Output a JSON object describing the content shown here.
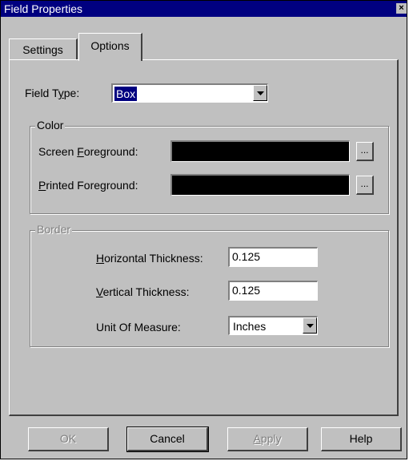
{
  "window": {
    "title": "Field Properties",
    "close_glyph": "×"
  },
  "tabs": [
    {
      "label": "Settings",
      "active": false
    },
    {
      "label": "Options",
      "active": true
    }
  ],
  "field_type": {
    "label": "Field Type:",
    "value": "Box"
  },
  "color_group": {
    "legend": "Color",
    "screen_foreground": {
      "label": "Screen Foreground:",
      "color": "#000000",
      "button": "..."
    },
    "printed_foreground": {
      "label": "Printed Foreground:",
      "color": "#000000",
      "button": "..."
    }
  },
  "border_group": {
    "legend": "Border",
    "horizontal_thickness": {
      "label": "Horizontal Thickness:",
      "value": "0.125"
    },
    "vertical_thickness": {
      "label": "Vertical Thickness:",
      "value": "0.125"
    },
    "unit_of_measure": {
      "label": "Unit Of Measure:",
      "value": "Inches"
    }
  },
  "buttons": {
    "ok": "OK",
    "cancel": "Cancel",
    "apply": "Apply",
    "help": "Help"
  },
  "colors": {
    "face": "#c0c0c0",
    "title_bar": "#000080",
    "selection": "#000080"
  }
}
